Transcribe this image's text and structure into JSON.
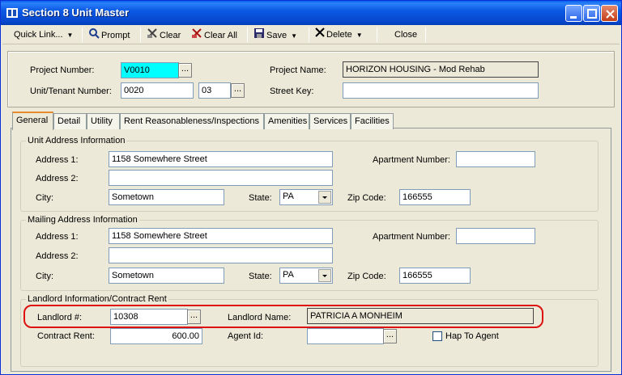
{
  "window": {
    "title": "Section 8 Unit Master",
    "icon": "app-icon"
  },
  "toolbar": {
    "quick_link": "Quick Link...",
    "prompt": "Prompt",
    "clear": "Clear",
    "clear_all": "Clear All",
    "save": "Save",
    "delete": "Delete",
    "close": "Close"
  },
  "header": {
    "project_number_label": "Project Number:",
    "project_number": "V0010",
    "project_name_label": "Project Name:",
    "project_name": "HORIZON HOUSING - Mod Rehab",
    "unit_tenant_label": "Unit/Tenant Number:",
    "unit_number": "0020",
    "tenant_number": "03",
    "street_key_label": "Street Key:",
    "street_key": ""
  },
  "tabs": [
    "General",
    "Detail",
    "Utility",
    "Rent Reasonableness/Inspections",
    "Amenities",
    "Services",
    "Facilities"
  ],
  "unit_address": {
    "title": "Unit Address Information",
    "address1_label": "Address 1:",
    "address1": "1158 Somewhere Street",
    "address2_label": "Address 2:",
    "address2": "",
    "city_label": "City:",
    "city": "Sometown",
    "state_label": "State:",
    "state": "PA",
    "zip_label": "Zip Code:",
    "zip": "166555",
    "apt_label": "Apartment Number:",
    "apt": ""
  },
  "mailing_address": {
    "title": "Mailing Address Information",
    "address1_label": "Address 1:",
    "address1": "1158 Somewhere Street",
    "address2_label": "Address 2:",
    "address2": "",
    "city_label": "City:",
    "city": "Sometown",
    "state_label": "State:",
    "state": "PA",
    "zip_label": "Zip Code:",
    "zip": "166555",
    "apt_label": "Apartment Number:",
    "apt": ""
  },
  "landlord": {
    "title": "Landlord Information/Contract Rent",
    "landlord_num_label": "Landlord #:",
    "landlord_num": "10308",
    "landlord_name_label": "Landlord Name:",
    "landlord_name": "PATRICIA A MONHEIM",
    "contract_rent_label": "Contract Rent:",
    "contract_rent": "600.00",
    "agent_id_label": "Agent Id:",
    "agent_id": "",
    "hap_label": "Hap To Agent"
  },
  "ellipsis": "...",
  "colors": {
    "title_bar": "#0b5ae5",
    "highlight": "#dd1111",
    "selected_field": "#00ffff"
  }
}
